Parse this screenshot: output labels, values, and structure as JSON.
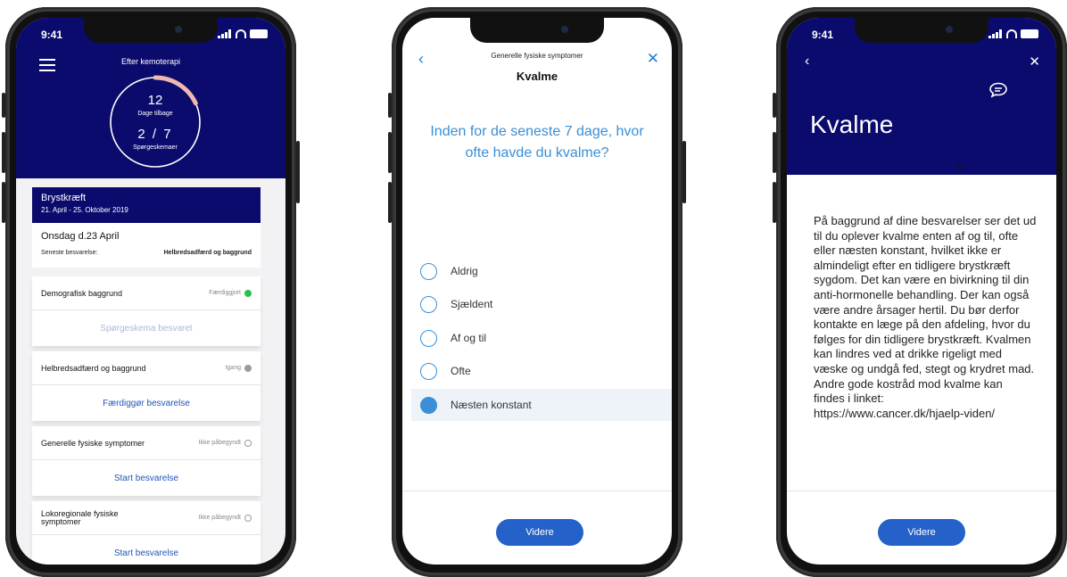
{
  "status": {
    "time": "9:41"
  },
  "phone1": {
    "title": "Efter kemoterapi",
    "ring": {
      "days": "12",
      "days_label": "Dage tilbage",
      "questionnaires": "2 / 7",
      "questionnaires_label": "Spørgeskemaer",
      "progress": 0.18
    },
    "program": {
      "name": "Brystkræft",
      "period": "21. April - 25. Oktober 2019"
    },
    "today": {
      "date": "Onsdag d.23 April",
      "latest_label": "Seneste besvarelse:",
      "latest_value": "Helbredsadfærd og baggrund"
    },
    "questionnaires": [
      {
        "name": "Demografisk baggrund",
        "status": "Færdiggjort",
        "status_color": "#2fc04a",
        "action": "Spørgeskema besvaret",
        "dim": true
      },
      {
        "name": "Helbredsadfærd og baggrund",
        "status": "Igang",
        "status_color": "#9a9a9a",
        "action": "Færdiggør besvarelse",
        "dim": false
      },
      {
        "name": "Generelle fysiske symptomer",
        "status": "Ikke påbegyndt",
        "status_color": "none",
        "action": "Start besvarelse",
        "dim": false
      },
      {
        "name": "Lokoregionale fysiske symptomer",
        "status": "Ikke påbegyndt",
        "status_color": "none",
        "action": "Start besvarelse",
        "dim": false
      }
    ]
  },
  "phone2": {
    "subtitle": "Generelle fysiske  symptomer",
    "title": "Kvalme",
    "question": "Inden for de seneste 7 dage, hvor ofte havde du kvalme?",
    "options": [
      "Aldrig",
      "Sjældent",
      "Af og til",
      "Ofte",
      "Næsten konstant"
    ],
    "selected_index": 4,
    "button": "Videre",
    "back_icon": "chevron-left-icon",
    "close_icon": "close-icon"
  },
  "phone3": {
    "title": "Kvalme",
    "body": "På baggrund af dine besvarelser ser det ud til du oplever kvalme enten af og til, ofte eller næsten konstant, hvilket ikke er almindeligt efter en tidligere brystkræft sygdom. Det kan være en bivirkning til din anti-hormonelle behandling. Der kan også være andre årsager hertil. Du bør derfor kontakte en læge på den afdeling, hvor du følges for din tidligere brystkræft. Kvalmen kan lindres ved at drikke rigeligt med væske og undgå fed, stegt og krydret mad. Andre gode kostråd mod kvalme kan findes i linket: https://www.cancer.dk/hjaelp-viden/",
    "button": "Videre",
    "chat_icon": "chat-icon"
  },
  "colors": {
    "navy": "#0b0b6e",
    "accent": "#2462c9",
    "link": "#3a8fd6",
    "progress": "#f0b8b0"
  }
}
